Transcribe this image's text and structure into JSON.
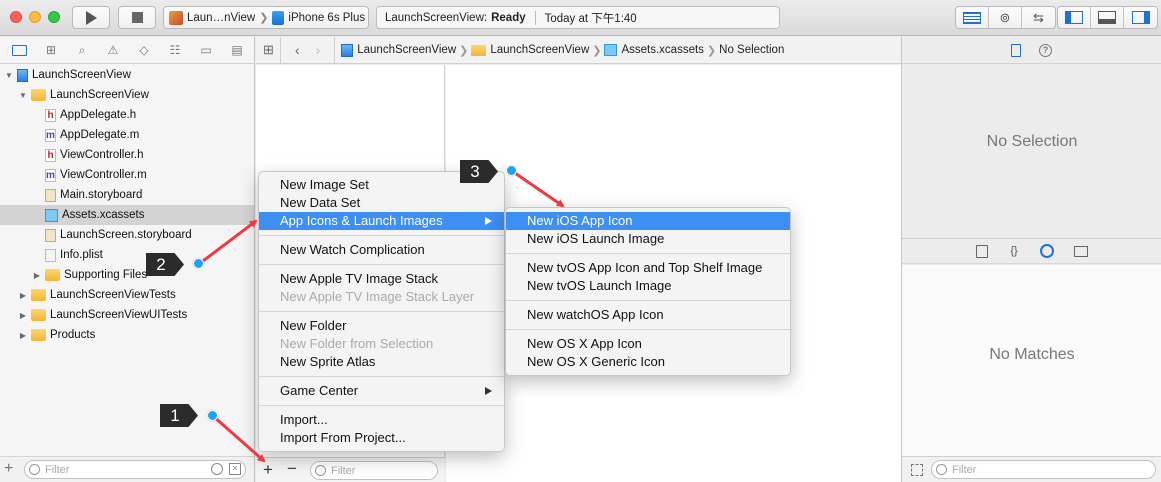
{
  "toolbar": {
    "scheme_target": "Laun…nView",
    "device": "iPhone 6s Plus",
    "activity_project": "LaunchScreenView:",
    "activity_status": "Ready",
    "activity_time": "Today at 下午1:40"
  },
  "navigator": {
    "items": [
      {
        "label": "LaunchScreenView",
        "kind": "project",
        "level": 0,
        "expanded": true
      },
      {
        "label": "LaunchScreenView",
        "kind": "folder",
        "level": 1,
        "expanded": true
      },
      {
        "label": "AppDelegate.h",
        "kind": "h",
        "level": 2
      },
      {
        "label": "AppDelegate.m",
        "kind": "m",
        "level": 2
      },
      {
        "label": "ViewController.h",
        "kind": "h",
        "level": 2
      },
      {
        "label": "ViewController.m",
        "kind": "m",
        "level": 2
      },
      {
        "label": "Main.storyboard",
        "kind": "storyboard",
        "level": 2
      },
      {
        "label": "Assets.xcassets",
        "kind": "xcassets",
        "level": 2,
        "selected": true
      },
      {
        "label": "LaunchScreen.storyboard",
        "kind": "storyboard",
        "level": 2
      },
      {
        "label": "Info.plist",
        "kind": "plist",
        "level": 2
      },
      {
        "label": "Supporting Files",
        "kind": "folder",
        "level": 2,
        "expanded": false
      },
      {
        "label": "LaunchScreenViewTests",
        "kind": "folder",
        "level": 1,
        "expanded": false
      },
      {
        "label": "LaunchScreenViewUITests",
        "kind": "folder",
        "level": 1,
        "expanded": false
      },
      {
        "label": "Products",
        "kind": "folder",
        "level": 1,
        "expanded": false
      }
    ],
    "filter_placeholder": "Filter"
  },
  "jumpbar": {
    "crumbs": [
      "LaunchScreenView",
      "LaunchScreenView",
      "Assets.xcassets",
      "No Selection"
    ]
  },
  "editor": {
    "filter_placeholder": "Filter"
  },
  "inspector": {
    "no_selection": "No Selection",
    "no_matches": "No Matches",
    "filter_placeholder": "Filter"
  },
  "context_menu": {
    "items": [
      "New Image Set",
      "New Data Set",
      "App Icons & Launch Images",
      "New Watch Complication",
      "New Apple TV Image Stack",
      "New Apple TV Image Stack Layer",
      "New Folder",
      "New Folder from Selection",
      "New Sprite Atlas",
      "Game Center",
      "Import...",
      "Import From Project..."
    ]
  },
  "submenu": {
    "items": [
      "New iOS App Icon",
      "New iOS Launch Image",
      "New tvOS App Icon and Top Shelf Image",
      "New tvOS Launch Image",
      "New watchOS App Icon",
      "New OS X App Icon",
      "New OS X Generic Icon"
    ]
  },
  "callouts": {
    "one": "1",
    "two": "2",
    "three": "3"
  },
  "colors": {
    "highlight": "#3d8ff4",
    "arrow": "#f0393f",
    "dot": "#1ea4ef"
  }
}
